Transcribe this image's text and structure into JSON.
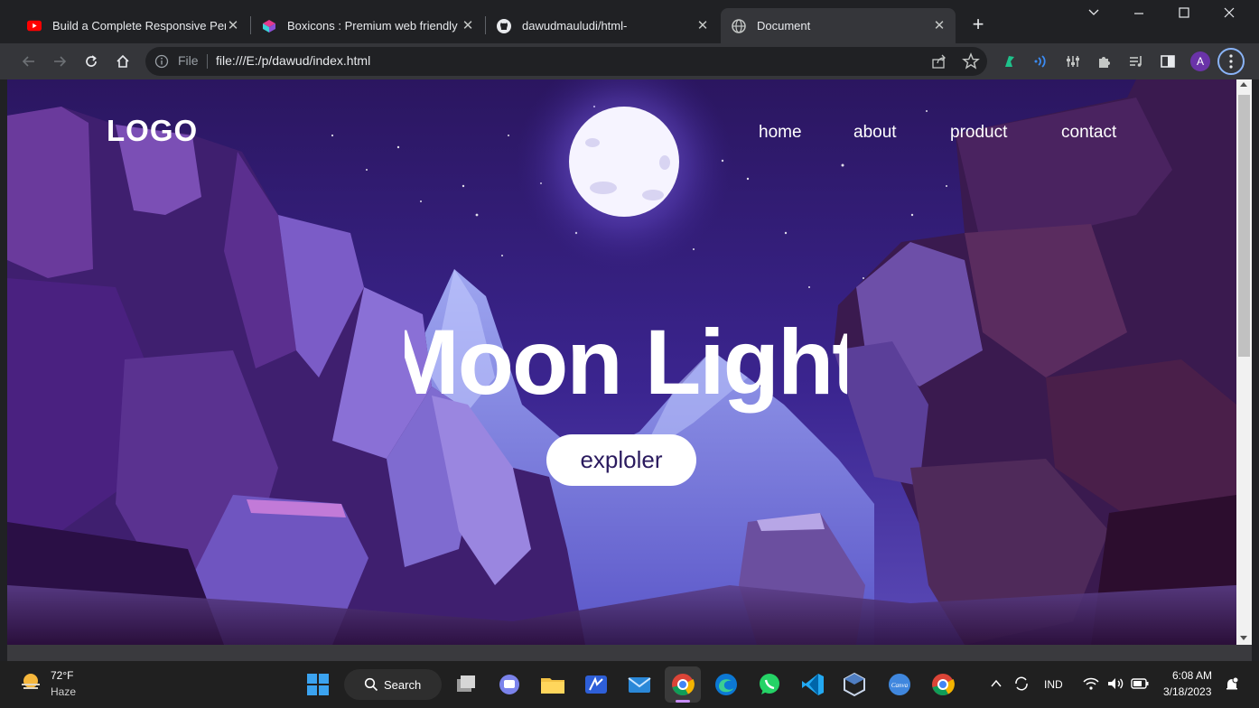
{
  "browser": {
    "tabs": [
      {
        "title": "Build a Complete Responsive Per",
        "icon": "youtube-icon",
        "active": false
      },
      {
        "title": "Boxicons : Premium web friendly",
        "icon": "boxicons-icon",
        "active": false
      },
      {
        "title": "dawudmauludi/html-",
        "icon": "github-icon",
        "active": false
      },
      {
        "title": "Document",
        "icon": "globe-icon",
        "active": true
      }
    ],
    "new_tab_label": "+",
    "address": {
      "scheme_label": "File",
      "url": "file:///E:/p/dawud/index.html"
    },
    "profile_initial": "A"
  },
  "page": {
    "logo": "LOGO",
    "nav": [
      "home",
      "about",
      "product",
      "contact"
    ],
    "hero_title": "Moon Light",
    "cta": "exploler",
    "colors": {
      "sky_top": "#2b1660",
      "sky_mid": "#3b2590",
      "moon": "#ffffff",
      "cliff_dark": "#2a0f45"
    }
  },
  "taskbar": {
    "weather": {
      "temp": "72°F",
      "condition": "Haze"
    },
    "search_label": "Search",
    "language": "IND",
    "time": "6:08 AM",
    "date": "3/18/2023"
  }
}
